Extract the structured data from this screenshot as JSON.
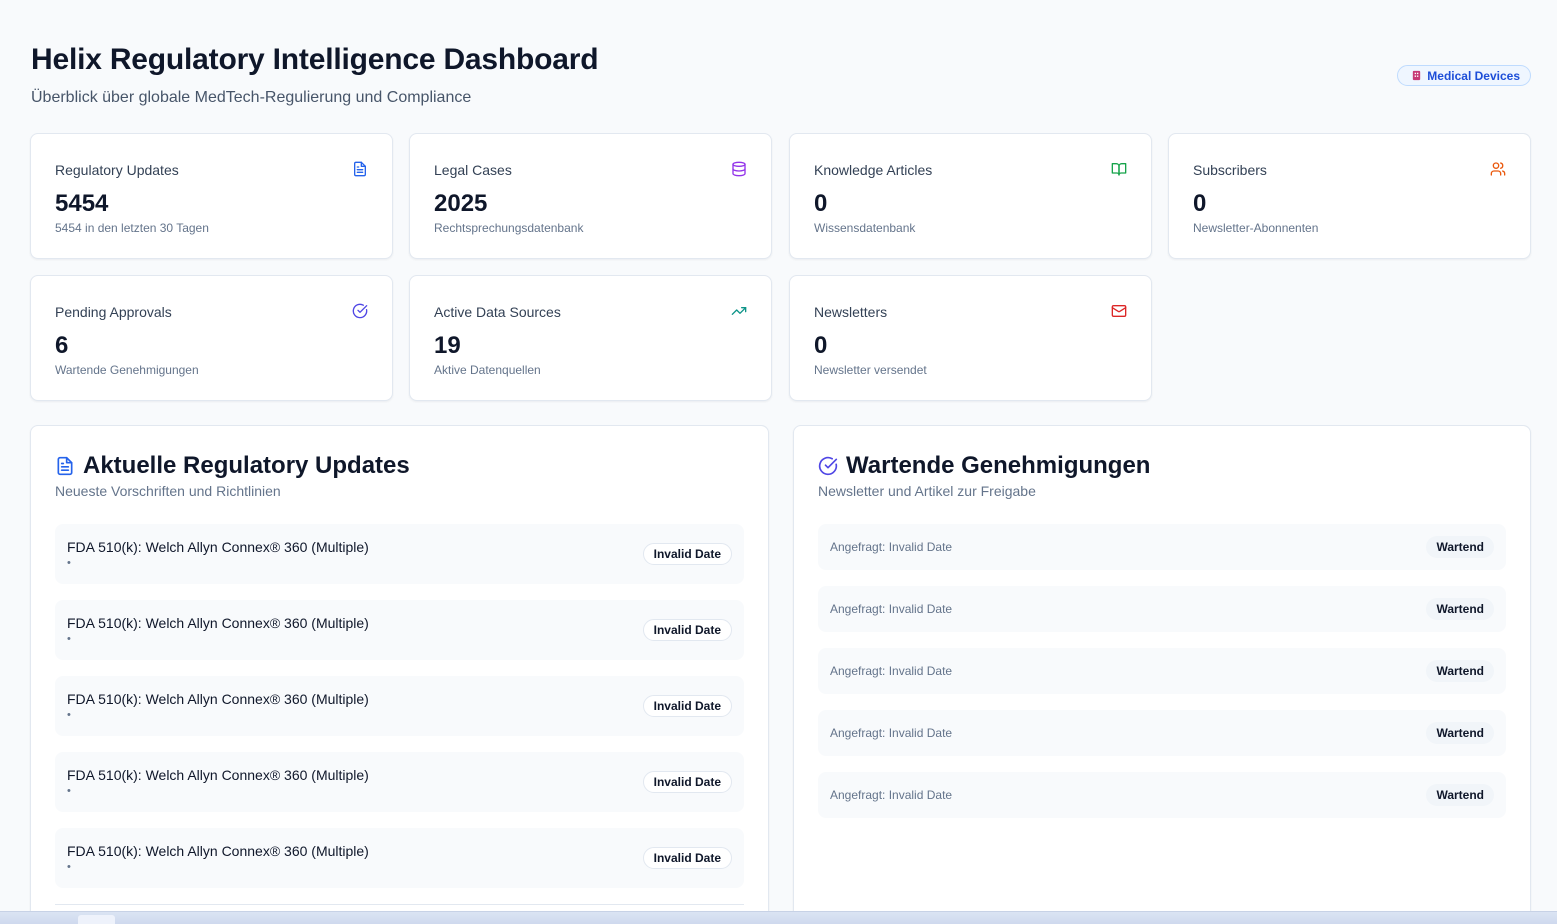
{
  "header": {
    "title": "Helix Regulatory Intelligence Dashboard",
    "subtitle": "Überblick über globale MedTech-Regulierung und Compliance",
    "domain_badge": "Medical Devices"
  },
  "stats": [
    {
      "label": "Regulatory Updates",
      "value": "5454",
      "description": "5454 in den letzten 30 Tagen",
      "icon": "file-text-icon",
      "color": "#2563eb"
    },
    {
      "label": "Legal Cases",
      "value": "2025",
      "description": "Rechtsprechungsdatenbank",
      "icon": "database-icon",
      "color": "#9333ea"
    },
    {
      "label": "Knowledge Articles",
      "value": "0",
      "description": "Wissensdatenbank",
      "icon": "book-open-icon",
      "color": "#16a34a"
    },
    {
      "label": "Subscribers",
      "value": "0",
      "description": "Newsletter-Abonnenten",
      "icon": "users-icon",
      "color": "#ea580c"
    },
    {
      "label": "Pending Approvals",
      "value": "6",
      "description": "Wartende Genehmigungen",
      "icon": "check-circle-icon",
      "color": "#4f46e5"
    },
    {
      "label": "Active Data Sources",
      "value": "19",
      "description": "Aktive Datenquellen",
      "icon": "trending-up-icon",
      "color": "#0d9488"
    },
    {
      "label": "Newsletters",
      "value": "0",
      "description": "Newsletter versendet",
      "icon": "mail-icon",
      "color": "#dc2626"
    }
  ],
  "updates_panel": {
    "title": "Aktuelle Regulatory Updates",
    "subtitle": "Neueste Vorschriften und Richtlinien",
    "icon": "file-text-icon",
    "items": [
      {
        "title": "FDA 510(k): Welch Allyn Connex® 360 (Multiple)",
        "meta": "•",
        "date": "Invalid Date"
      },
      {
        "title": "FDA 510(k): Welch Allyn Connex® 360 (Multiple)",
        "meta": "•",
        "date": "Invalid Date"
      },
      {
        "title": "FDA 510(k): Welch Allyn Connex® 360 (Multiple)",
        "meta": "•",
        "date": "Invalid Date"
      },
      {
        "title": "FDA 510(k): Welch Allyn Connex® 360 (Multiple)",
        "meta": "•",
        "date": "Invalid Date"
      },
      {
        "title": "FDA 510(k): Welch Allyn Connex® 360 (Multiple)",
        "meta": "•",
        "date": "Invalid Date"
      }
    ]
  },
  "approvals_panel": {
    "title": "Wartende Genehmigungen",
    "subtitle": "Newsletter und Artikel zur Freigabe",
    "icon": "check-circle-icon",
    "items": [
      {
        "text": "Angefragt: Invalid Date",
        "status": "Wartend"
      },
      {
        "text": "Angefragt: Invalid Date",
        "status": "Wartend"
      },
      {
        "text": "Angefragt: Invalid Date",
        "status": "Wartend"
      },
      {
        "text": "Angefragt: Invalid Date",
        "status": "Wartend"
      },
      {
        "text": "Angefragt: Invalid Date",
        "status": "Wartend"
      }
    ]
  }
}
